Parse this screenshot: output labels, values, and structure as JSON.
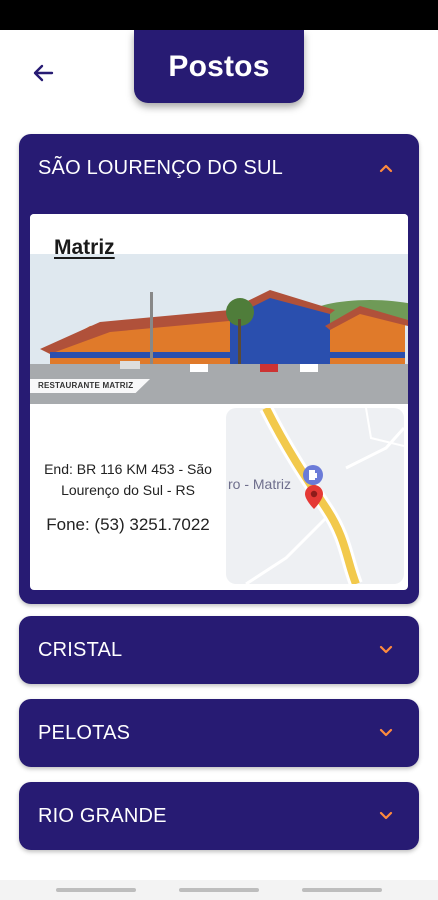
{
  "header": {
    "title": "Postos",
    "back_icon": "arrow-left-icon"
  },
  "colors": {
    "primary": "#271b73",
    "accent": "#ff8a3d",
    "card": "#ffffff",
    "map_road": "#f2c94c",
    "pin": "#e53935"
  },
  "sections": [
    {
      "name": "SÃO LOURENÇO DO SUL",
      "expanded": true,
      "card": {
        "title": "Matriz",
        "photo_caption": "RESTAURANTE MATRIZ",
        "address": "End: BR 116 KM 453 - São Lourenço do Sul - RS",
        "phone": "Fone: (53) 3251.7022",
        "map_label": "ro - Matriz"
      }
    },
    {
      "name": "CRISTAL",
      "expanded": false
    },
    {
      "name": "PELOTAS",
      "expanded": false
    },
    {
      "name": "RIO GRANDE",
      "expanded": false
    }
  ]
}
